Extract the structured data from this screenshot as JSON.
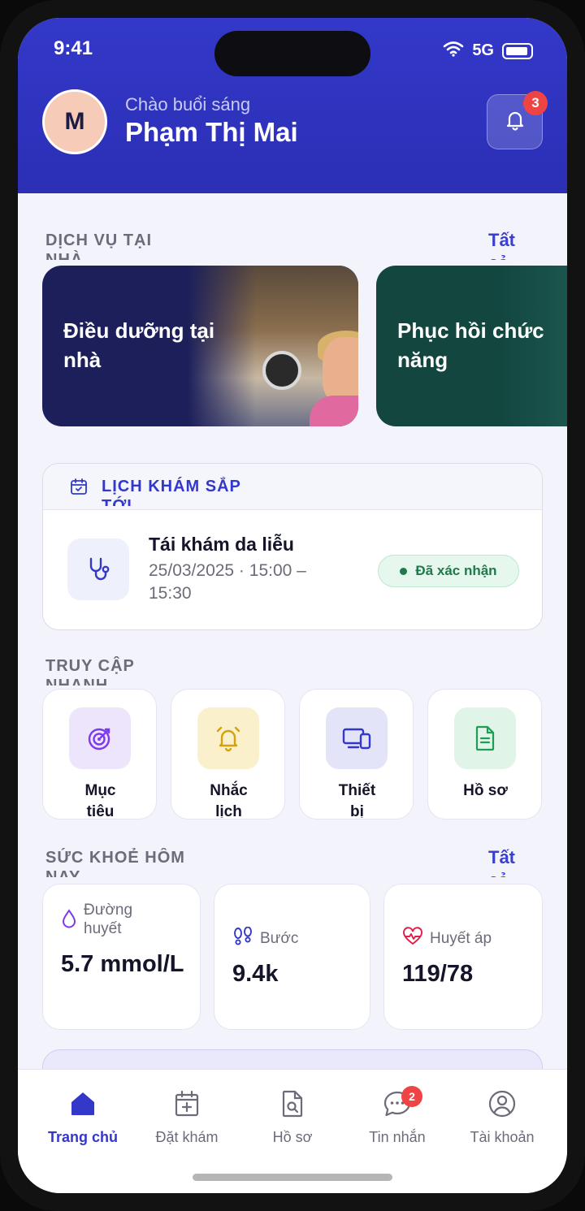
{
  "status_bar": {
    "time": "9:41",
    "network": "5G"
  },
  "header": {
    "avatar_initial": "M",
    "greeting": "Chào buổi sáng",
    "user_name": "Phạm Thị Mai",
    "notification_count": "3"
  },
  "home_services": {
    "title": "DỊCH VỤ TẠI NHÀ",
    "see_all": "Tất cả",
    "cards": [
      {
        "label": "Điều dưỡng tại nhà"
      },
      {
        "label": "Phục hồi chức năng"
      }
    ]
  },
  "upcoming": {
    "title": "LỊCH KHÁM SẮP TỚI",
    "appointment": {
      "title": "Tái khám da liễu",
      "time": "25/03/2025 · 15:00 – 15:30",
      "status": "Đã xác nhận"
    }
  },
  "quick_access": {
    "title": "TRUY CẬP NHANH",
    "items": [
      {
        "label": "Mục tiêu",
        "icon": "target-icon",
        "color": "#7c3aed"
      },
      {
        "label": "Nhắc lịch",
        "icon": "alarm-bell-icon",
        "color": "#d4a20a"
      },
      {
        "label": "Thiết bị",
        "icon": "devices-icon",
        "color": "#3338c9"
      },
      {
        "label": "Hồ sơ",
        "icon": "document-icon",
        "color": "#1f9d55"
      }
    ]
  },
  "health_today": {
    "title": "SỨC KHOẺ HÔM NAY",
    "see_all": "Tất cả",
    "metrics": [
      {
        "label": "Đường huyết",
        "value": "5.7 mmol/L",
        "icon": "droplet-icon"
      },
      {
        "label": "Bước",
        "value": "9.4k",
        "icon": "footsteps-icon"
      },
      {
        "label": "Huyết áp",
        "value": "119/78",
        "icon": "heartbeat-icon"
      }
    ]
  },
  "bottom_nav": {
    "items": [
      {
        "label": "Trang chủ",
        "icon": "home-icon",
        "active": true
      },
      {
        "label": "Đặt khám",
        "icon": "calendar-plus-icon"
      },
      {
        "label": "Hồ sơ",
        "icon": "file-search-icon"
      },
      {
        "label": "Tin nhắn",
        "icon": "chat-icon",
        "badge": "2"
      },
      {
        "label": "Tài khoản",
        "icon": "user-circle-icon"
      }
    ]
  },
  "colors": {
    "primary": "#3338c9",
    "badge": "#ef4444",
    "success": "#1f7a49"
  }
}
